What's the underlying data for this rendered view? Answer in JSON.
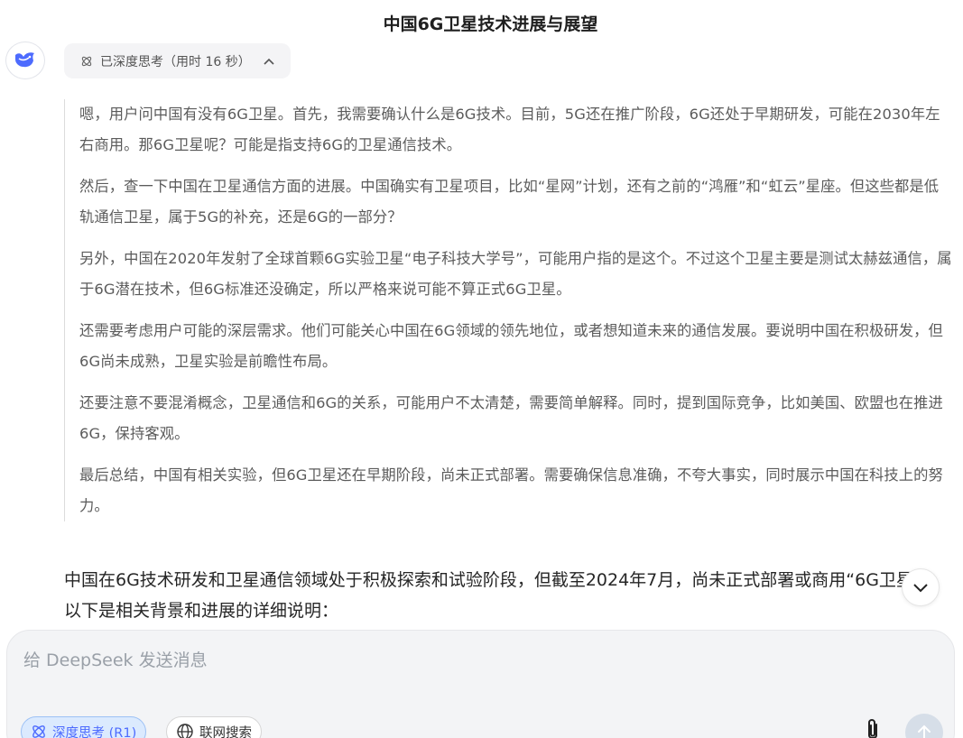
{
  "header": {
    "title": "中国6G卫星技术进展与展望"
  },
  "assistant": {
    "avatar_icon": "deepseek-whale-icon",
    "thinking_toggle": {
      "label": "已深度思考（用时 16 秒）",
      "icon": "atom-icon",
      "expanded": true
    },
    "thinking": [
      "嗯，用户问中国有没有6G卫星。首先，我需要确认什么是6G技术。目前，5G还在推广阶段，6G还处于早期研发，可能在2030年左右商用。那6G卫星呢？可能是指支持6G的卫星通信技术。",
      "然后，查一下中国在卫星通信方面的进展。中国确实有卫星项目，比如“星网”计划，还有之前的“鸿雁”和“虹云”星座。但这些都是低轨通信卫星，属于5G的补充，还是6G的一部分？",
      "另外，中国在2020年发射了全球首颗6G实验卫星“电子科技大学号”，可能用户指的是这个。不过这个卫星主要是测试太赫兹通信，属于6G潜在技术，但6G标准还没确定，所以严格来说可能不算正式6G卫星。",
      "还需要考虑用户可能的深层需求。他们可能关心中国在6G领域的领先地位，或者想知道未来的通信发展。要说明中国在积极研发，但6G尚未成熟，卫星实验是前瞻性布局。",
      "还要注意不要混淆概念，卫星通信和6G的关系，可能用户不太清楚，需要简单解释。同时，提到国际竞争，比如美国、欧盟也在推进6G，保持客观。",
      "最后总结，中国有相关实验，但6G卫星还在早期阶段，尚未正式部署。需要确保信息准确，不夸大事实，同时展示中国在科技上的努力。"
    ],
    "answer": "中国在6G技术研发和卫星通信领域处于积极探索和试验阶段，但截至2024年7月，尚未正式部署或商用“6G卫星”。以下是相关背景和进展的详细说明："
  },
  "composer": {
    "placeholder": "给 DeepSeek 发送消息",
    "value": "",
    "deep_think_label": "深度思考 (R1)",
    "web_search_label": "联网搜索",
    "accent": "#4d6bfe"
  }
}
